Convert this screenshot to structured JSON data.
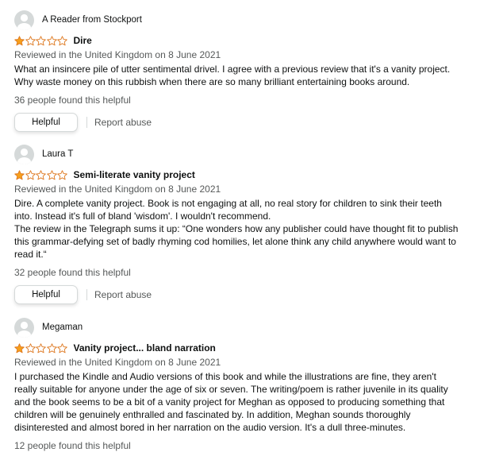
{
  "colors": {
    "star": "#f7a01c",
    "star_outline": "#de7921",
    "text": "#0f1111",
    "muted": "#565959",
    "border": "#d5d9d9"
  },
  "icons": {
    "avatar": "default-profile-icon",
    "star": "star-icon"
  },
  "reviews": [
    {
      "reviewer": "A Reader from Stockport",
      "rating": 1,
      "rating_max": 5,
      "title": "Dire",
      "date": "Reviewed in the United Kingdom on 8 June 2021",
      "body": [
        "What an insincere pile of utter sentimental drivel. I agree with a previous review that it's a vanity project. Why waste money on this rubbish when there are so many brilliant entertaining books around."
      ],
      "helpful_count": "36 people found this helpful",
      "helpful_label": "Helpful",
      "report_label": "Report abuse"
    },
    {
      "reviewer": "Laura T",
      "rating": 1,
      "rating_max": 5,
      "title": "Semi-literate vanity project",
      "date": "Reviewed in the United Kingdom on 8 June 2021",
      "body": [
        "Dire. A complete vanity project. Book is not engaging at all, no real story for children to sink their teeth into. Instead it's full of bland 'wisdom'. I wouldn't recommend.",
        "The review in the Telegraph sums it up: “One wonders how any publisher could have thought fit to publish this grammar-defying set of badly rhyming cod homilies, let alone think any child anywhere would want to read it.“"
      ],
      "helpful_count": "32 people found this helpful",
      "helpful_label": "Helpful",
      "report_label": "Report abuse"
    },
    {
      "reviewer": "Megaman",
      "rating": 1,
      "rating_max": 5,
      "title": "Vanity project... bland narration",
      "date": "Reviewed in the United Kingdom on 8 June 2021",
      "body": [
        "I purchased the Kindle and Audio versions of this book and while the illustrations are fine, they aren't really suitable for anyone under the age of six or seven. The writing/poem is rather juvenile in its quality and the book seems to be a bit of a vanity project for Meghan as opposed to producing something that children will be genuinely enthralled and fascinated by. In addition, Meghan sounds thoroughly disinterested and almost bored in her narration on the audio version. It's a dull three-minutes."
      ],
      "helpful_count": "12 people found this helpful"
    }
  ]
}
